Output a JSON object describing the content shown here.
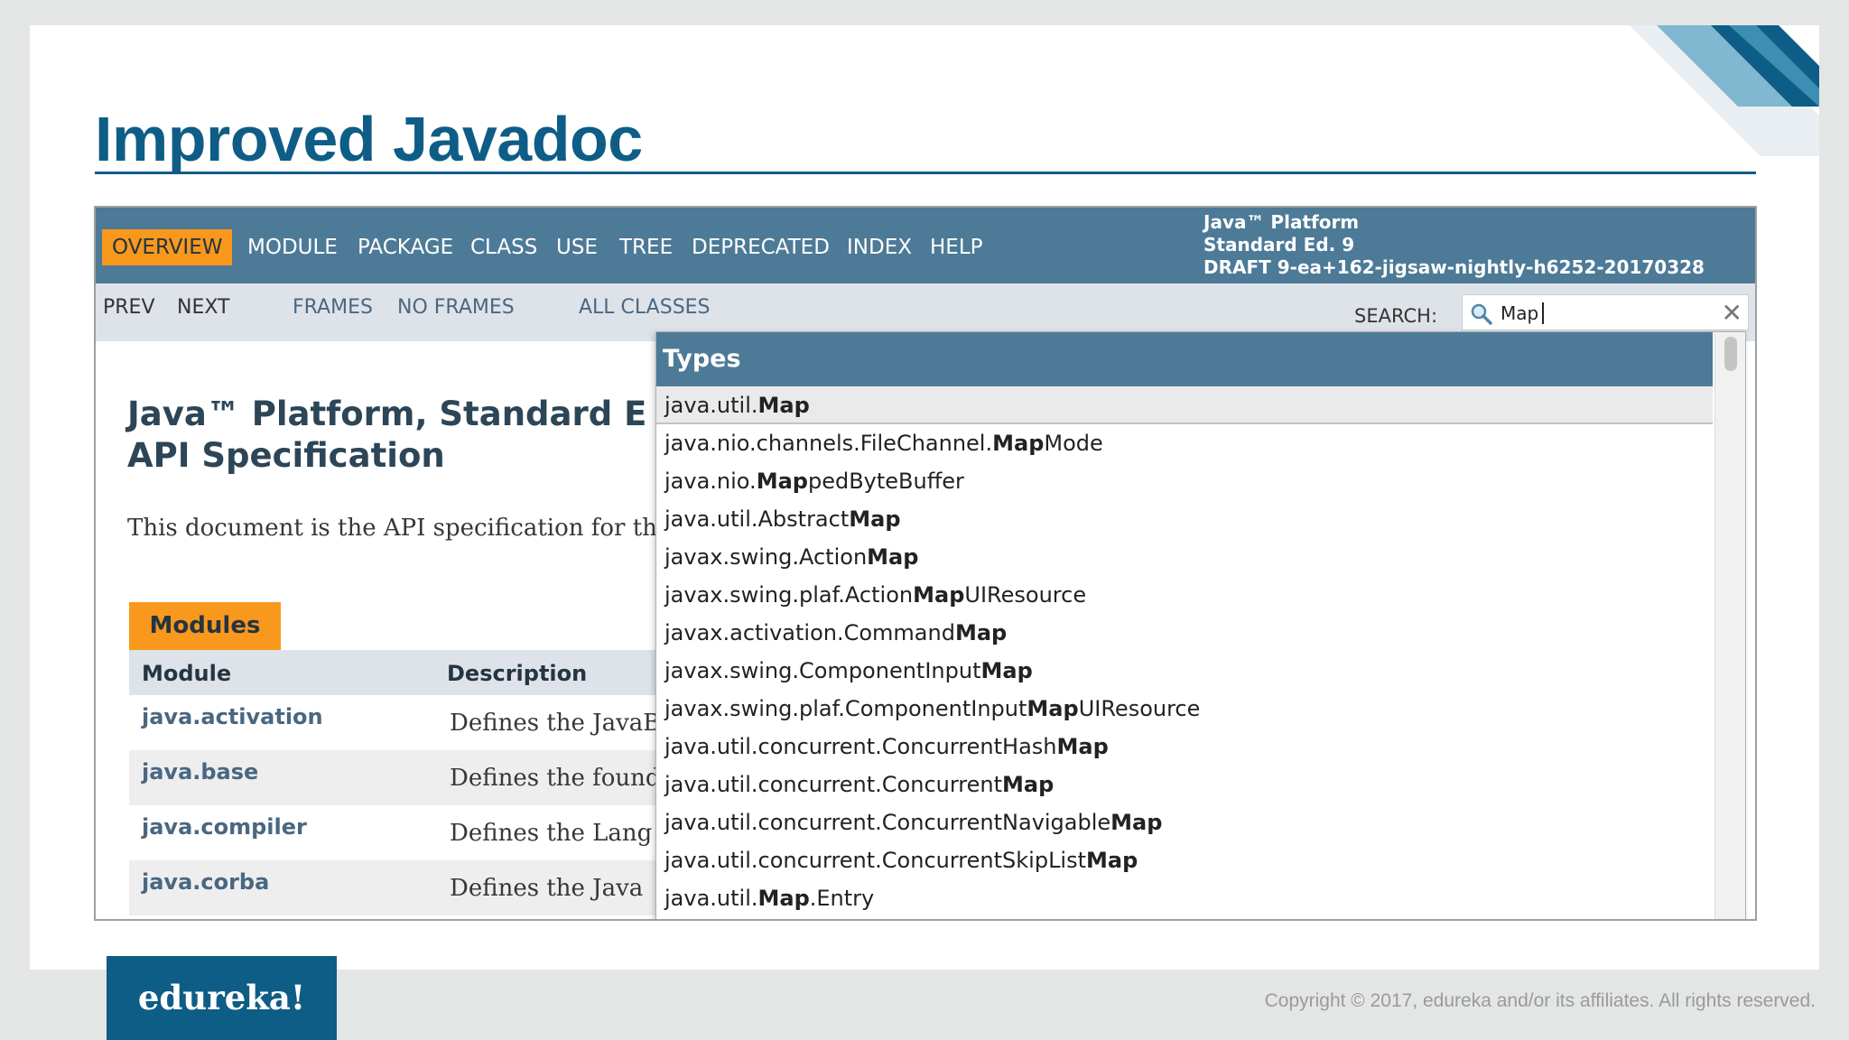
{
  "slide": {
    "title": "Improved Javadoc",
    "copyright": "Copyright © 2017, edureka and/or its affiliates. All rights reserved.",
    "logo_text": "edureka!"
  },
  "javadoc": {
    "top_nav": [
      "OVERVIEW",
      "MODULE",
      "PACKAGE",
      "CLASS",
      "USE",
      "TREE",
      "DEPRECATED",
      "INDEX",
      "HELP"
    ],
    "active_nav": "OVERVIEW",
    "brand_lines": [
      "Java™ Platform",
      "Standard Ed. 9",
      "DRAFT 9-ea+162-jigsaw-nightly-h6252-20170328"
    ],
    "sub_nav": {
      "prev": "PREV",
      "next": "NEXT",
      "frames": "FRAMES",
      "no_frames": "NO FRAMES",
      "all_classes": "ALL CLASSES"
    },
    "search": {
      "label": "SEARCH:",
      "value": "Map",
      "clear_icon": "close-icon"
    },
    "page_title": "Java™ Platform, Standard E\nAPI Specification",
    "description": "This document is the API specification for th",
    "modules_tab": "Modules",
    "table_headers": {
      "module": "Module",
      "description": "Description"
    },
    "modules": [
      {
        "name": "java.activation",
        "desc": "Defines the JavaB"
      },
      {
        "name": "java.base",
        "desc": "Defines the found"
      },
      {
        "name": "java.compiler",
        "desc": "Defines the Lang"
      },
      {
        "name": "java.corba",
        "desc": "Defines the Java"
      }
    ]
  },
  "dropdown": {
    "header": "Types",
    "selected_index": 0,
    "items": [
      [
        "java.util.",
        "Map",
        ""
      ],
      [
        "java.nio.channels.FileChannel.",
        "Map",
        "Mode"
      ],
      [
        "java.nio.",
        "Map",
        "pedByteBuffer"
      ],
      [
        "java.util.Abstract",
        "Map",
        ""
      ],
      [
        "javax.swing.Action",
        "Map",
        ""
      ],
      [
        "javax.swing.plaf.Action",
        "Map",
        "UIResource"
      ],
      [
        "javax.activation.Command",
        "Map",
        ""
      ],
      [
        "javax.swing.ComponentInput",
        "Map",
        ""
      ],
      [
        "javax.swing.plaf.ComponentInput",
        "Map",
        "UIResource"
      ],
      [
        "java.util.concurrent.ConcurrentHash",
        "Map",
        ""
      ],
      [
        "java.util.concurrent.Concurrent",
        "Map",
        ""
      ],
      [
        "java.util.concurrent.ConcurrentNavigable",
        "Map",
        ""
      ],
      [
        "java.util.concurrent.ConcurrentSkipList",
        "Map",
        ""
      ],
      [
        "java.util.",
        "Map",
        ".Entry"
      ]
    ]
  },
  "colors": {
    "title_blue": "#0e5d86",
    "nav_blue": "#4d7a97",
    "accent_orange": "#f8981d",
    "subnav_gray": "#dee3e9"
  }
}
